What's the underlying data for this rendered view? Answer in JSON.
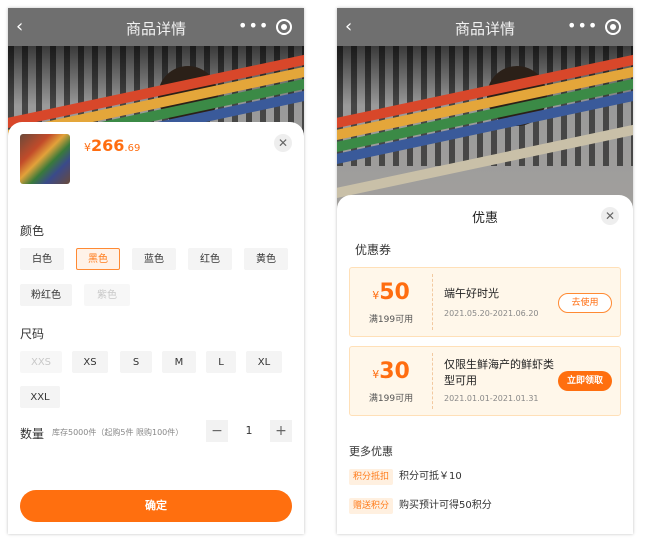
{
  "nav": {
    "title": "商品详情",
    "back_icon": "chevron-left-icon",
    "more_icon": "more-dots-icon",
    "target_icon": "target-icon"
  },
  "left_sheet": {
    "price": {
      "currency": "¥",
      "integer": "266",
      "decimal": ".69"
    },
    "color_label": "颜色",
    "colors": [
      {
        "label": "白色",
        "state": "normal"
      },
      {
        "label": "黑色",
        "state": "selected"
      },
      {
        "label": "蓝色",
        "state": "normal"
      },
      {
        "label": "红色",
        "state": "normal"
      },
      {
        "label": "黄色",
        "state": "normal"
      },
      {
        "label": "粉红色",
        "state": "normal"
      },
      {
        "label": "紫色",
        "state": "disabled"
      }
    ],
    "size_label": "尺码",
    "sizes": [
      {
        "label": "XXS",
        "state": "disabled"
      },
      {
        "label": "XS",
        "state": "normal"
      },
      {
        "label": "S",
        "state": "normal"
      },
      {
        "label": "M",
        "state": "normal"
      },
      {
        "label": "L",
        "state": "normal"
      },
      {
        "label": "XL",
        "state": "normal"
      },
      {
        "label": "XXL",
        "state": "normal"
      }
    ],
    "quantity_label": "数量",
    "quantity_note": "库存5000件（起购5件 限购100件）",
    "quantity_value": "1",
    "minus": "−",
    "plus": "+",
    "confirm_label": "确定",
    "close_symbol": "✕"
  },
  "right_sheet": {
    "title": "优惠",
    "close_symbol": "✕",
    "coupons_label": "优惠券",
    "coupons": [
      {
        "currency": "¥",
        "amount": "50",
        "condition": "满199可用",
        "name": "端午好时光",
        "date": "2021.05.20-2021.06.20",
        "action": "去使用"
      },
      {
        "currency": "¥",
        "amount": "30",
        "condition": "满199可用",
        "name": "仅限生鲜海产的鲜虾类型可用",
        "date": "2021.01.01-2021.01.31",
        "action": "立即领取"
      }
    ],
    "more_label": "更多优惠",
    "promos": [
      {
        "tag": "积分抵扣",
        "text": "积分可抵￥10"
      },
      {
        "tag": "赠送积分",
        "text": "购买预计可得50积分"
      }
    ]
  },
  "colors": {
    "accent": "#ff6f0f",
    "selected_bg": "#fff2e8",
    "coupon_bg": "#fff7ea"
  }
}
